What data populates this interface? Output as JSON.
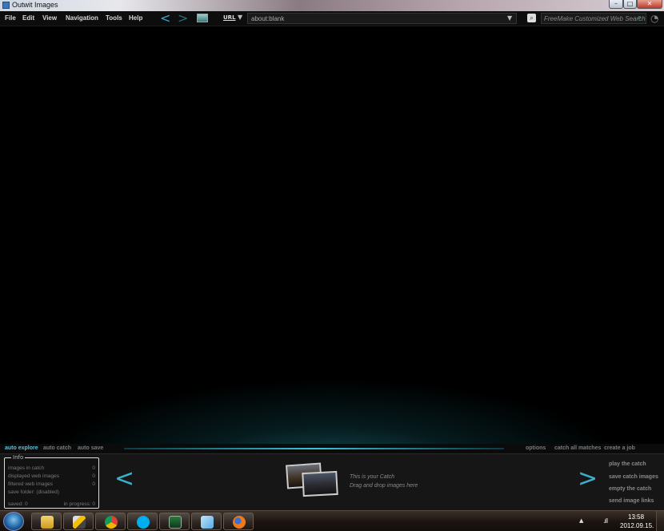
{
  "window": {
    "title": "Outwit Images"
  },
  "menu": [
    "File",
    "Edit",
    "View",
    "Navigation",
    "Tools",
    "Help"
  ],
  "toolbar": {
    "url_label": "URL",
    "url_value": "about:blank",
    "search_placeholder": "FreeMake Customized Web Search"
  },
  "modes": {
    "auto_explore": "auto explore",
    "auto_catch": "auto catch",
    "auto_save": "auto save",
    "options": "options",
    "catch_all": "catch all matches",
    "create_job": "create a job"
  },
  "info": {
    "title": "Info",
    "rows": [
      {
        "label": "images in catch",
        "value": "0"
      },
      {
        "label": "displayed web images",
        "value": "0"
      },
      {
        "label": "filtered web images",
        "value": "0"
      },
      {
        "label": "save folder:  (disabled)",
        "value": ""
      }
    ],
    "saved": "saved:  0",
    "in_progress": "in progress:  0"
  },
  "catch": {
    "line1": "This is your Catch",
    "line2": "Drag and drop images here"
  },
  "actions": [
    "play the catch",
    "save catch images",
    "empty the catch",
    "send image links"
  ],
  "taskbar": {
    "time": "13:58",
    "date": "2012.09.15."
  },
  "colors": {
    "accent": "#3ab0c8",
    "active_mode": "#4fc8e0"
  }
}
